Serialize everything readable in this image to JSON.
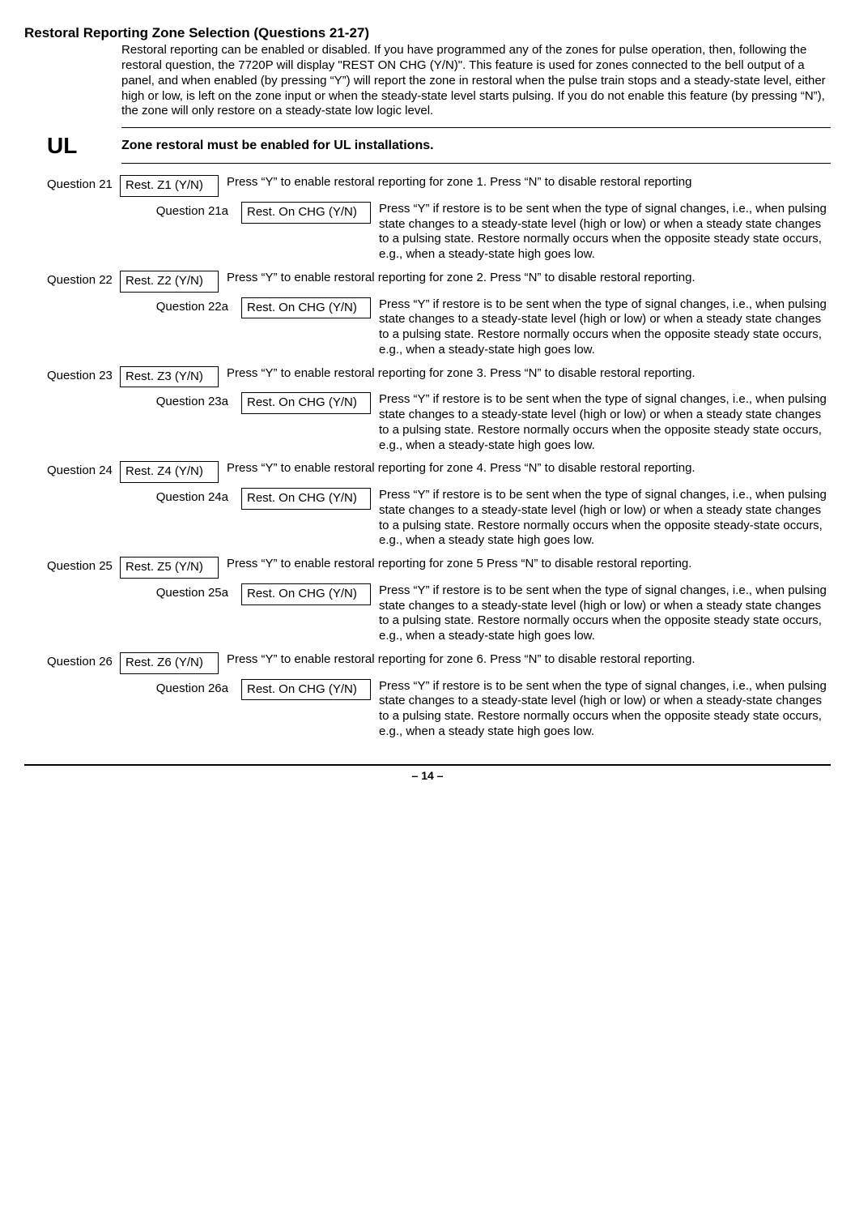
{
  "section": {
    "title": "Restoral Reporting Zone Selection (Questions 21-27)",
    "intro": "Restoral reporting can be enabled or disabled.  If you have programmed any of the zones for pulse operation, then, following the restoral question, the 7720P will display \"REST ON CHG (Y/N)\".  This feature is used for zones connected to the bell output of a panel, and when enabled (by pressing “Y”) will report the zone in restoral when the pulse train stops and a steady-state level, either high or low, is left on the zone input or when the steady-state level starts pulsing.  If you do not enable this feature (by pressing “N”), the zone will only restore on a steady-state low logic level."
  },
  "ul": {
    "label": "UL",
    "text": "Zone restoral must be enabled for UL installations."
  },
  "questions": [
    {
      "qLabel": "Question 21",
      "qBox": "Rest. Z1 (Y/N)",
      "qDesc": "Press “Y” to enable restoral reporting for zone 1.  Press “N” to disable restoral reporting",
      "subLabel": "Question 21a",
      "subBox": "Rest. On CHG (Y/N)",
      "subDesc": "Press “Y” if restore is to be sent when the type of signal changes, i.e., when pulsing state changes to a steady-state level (high or low) or when a steady state changes to a pulsing state.  Restore normally occurs when the opposite steady state occurs, e.g., when a steady-state high goes low."
    },
    {
      "qLabel": "Question 22",
      "qBox": "Rest. Z2 (Y/N)",
      "qDesc": "Press “Y” to enable restoral reporting for zone 2.  Press “N” to disable restoral reporting.",
      "subLabel": "Question 22a",
      "subBox": "Rest. On CHG (Y/N)",
      "subDesc": "Press “Y” if restore is to be sent when the type of signal changes, i.e., when pulsing state changes to a steady-state level (high or low) or when a steady state changes to a pulsing state.  Restore normally occurs when the opposite steady state occurs, e.g., when a steady-state high goes low."
    },
    {
      "qLabel": "Question 23",
      "qBox": "Rest. Z3 (Y/N)",
      "qDesc": "Press “Y” to enable restoral reporting for zone 3.  Press “N” to disable restoral reporting.",
      "subLabel": "Question 23a",
      "subBox": "Rest. On CHG (Y/N)",
      "subDesc": "Press “Y” if restore is to be sent when the type of signal changes, i.e., when pulsing state changes to a steady-state level (high or low) or when a steady state changes to a pulsing state.  Restore normally occurs when the opposite steady state occurs, e.g., when a steady-state high goes low."
    },
    {
      "qLabel": "Question 24",
      "qBox": "Rest. Z4 (Y/N)",
      "qDesc": "Press “Y” to enable restoral reporting for zone 4.  Press “N” to disable restoral reporting.",
      "subLabel": "Question 24a",
      "subBox": "Rest. On CHG (Y/N)",
      "subDesc": "Press “Y” if restore is to be sent when the type of signal changes, i.e., when pulsing state changes to a steady-state level (high or low) or when a steady state changes to a pulsing state.  Restore normally occurs when the opposite steady-state occurs, e.g., when a steady state high goes low."
    },
    {
      "qLabel": "Question 25",
      "qBox": "Rest. Z5 (Y/N)",
      "qDesc": "Press “Y” to enable restoral reporting for zone 5  Press “N” to disable restoral reporting.",
      "subLabel": "Question 25a",
      "subBox": "Rest. On CHG (Y/N)",
      "subDesc": "Press “Y” if restore is to be sent when the type of signal changes, i.e., when pulsing state changes to a steady-state level (high or low) or when a steady state changes to a pulsing state.  Restore normally occurs when the opposite steady state occurs, e.g., when a steady-state high goes low."
    },
    {
      "qLabel": "Question 26",
      "qBox": "Rest. Z6 (Y/N)",
      "qDesc": "Press “Y” to enable restoral reporting for zone 6.  Press “N” to disable restoral reporting.",
      "subLabel": "Question 26a",
      "subBox": "Rest. On CHG (Y/N)",
      "subDesc": "Press “Y” if restore is to be sent when the type of signal changes, i.e., when pulsing state changes to a steady-state level (high or low) or when a steady-state changes to a pulsing state.  Restore normally occurs when the opposite steady state occurs, e.g., when a steady state high goes low."
    }
  ],
  "footer": {
    "pageNum": "– 14 –"
  }
}
